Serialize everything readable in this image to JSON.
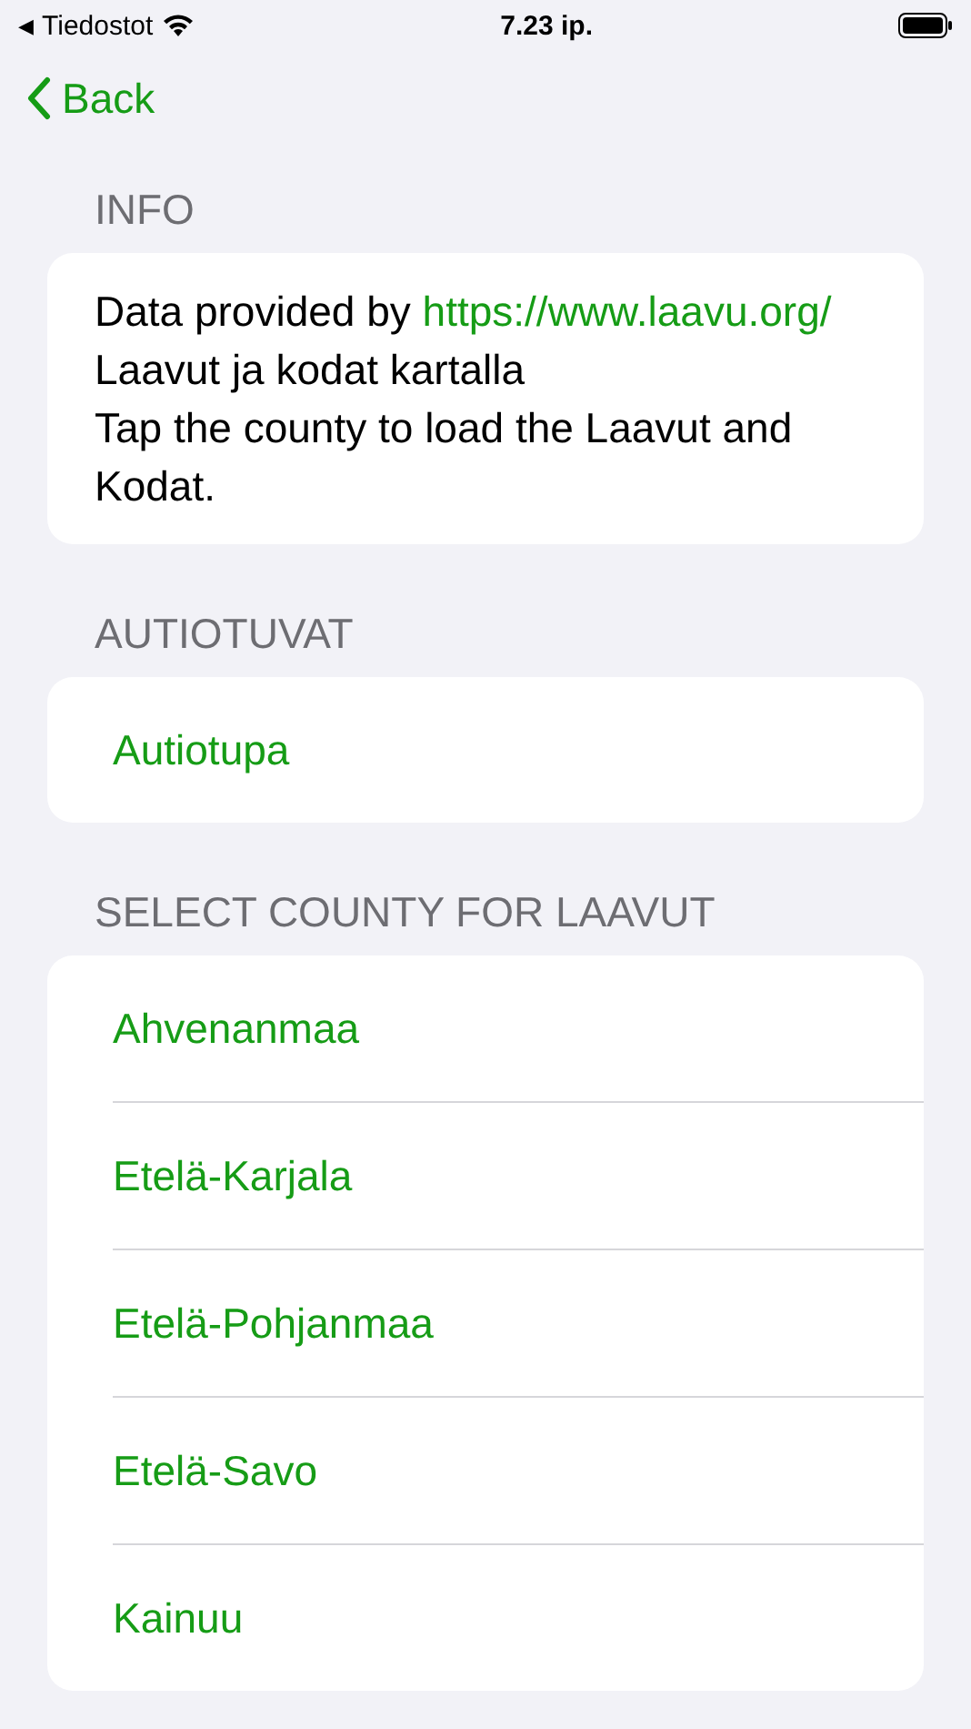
{
  "status_bar": {
    "back_indicator": "◀",
    "back_app": "Tiedostot",
    "time": "7.23 ip."
  },
  "nav": {
    "back": "Back"
  },
  "sections": [
    {
      "header": "INFO",
      "kind": "info",
      "prefix": "Data provided by ",
      "link": "https://www.laavu.org/",
      "lines": [
        "Laavut ja kodat kartalla",
        "Tap the county to load the Laavut and Kodat."
      ]
    },
    {
      "header": "AUTIOTUVAT",
      "kind": "list",
      "items": [
        "Autiotupa"
      ]
    },
    {
      "header": "SELECT COUNTY FOR LAAVUT",
      "kind": "list",
      "items": [
        "Ahvenanmaa",
        "Etelä-Karjala",
        "Etelä-Pohjanmaa",
        "Etelä-Savo",
        "Kainuu"
      ]
    }
  ]
}
